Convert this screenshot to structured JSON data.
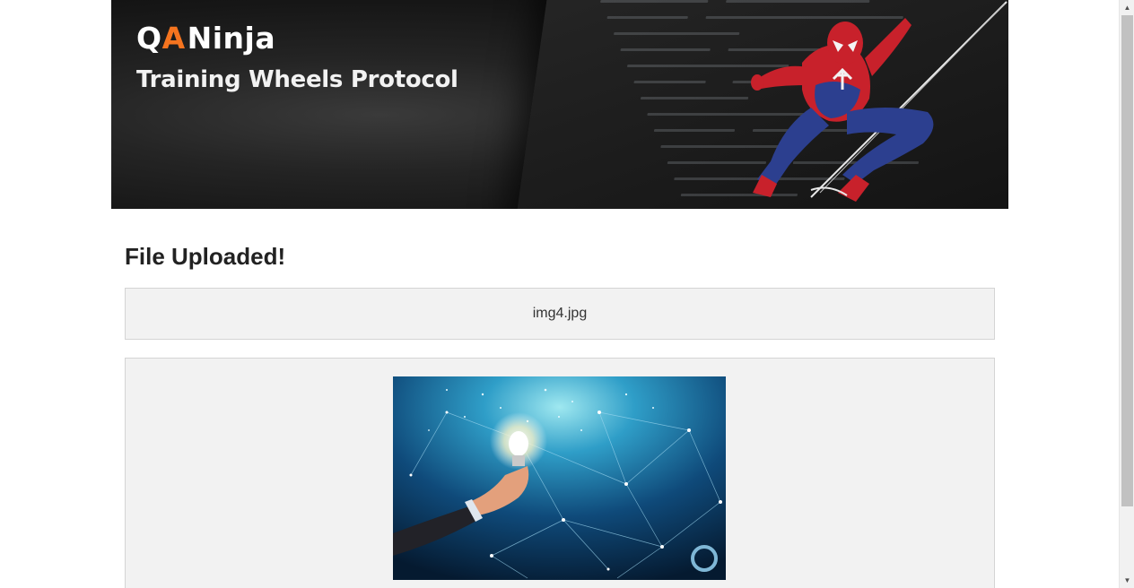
{
  "header": {
    "logo_q": "Q",
    "logo_a": "A",
    "logo_name": "Ninja",
    "tagline": "Training Wheels Protocol",
    "hero_image": "spiderman-figure",
    "background_image": "code-monitor-background"
  },
  "main": {
    "title": "File Uploaded!",
    "uploaded_filename": "img4.jpg",
    "preview_image": "lightbulb-network-image"
  },
  "colors": {
    "accent": "#f5741f",
    "panel_bg": "#f2f2f2",
    "panel_border": "#d4d4d4",
    "banner_bg": "#1a1a1a"
  },
  "scrollbar": {
    "up_icon": "scroll-up-icon",
    "down_icon": "scroll-down-icon"
  }
}
